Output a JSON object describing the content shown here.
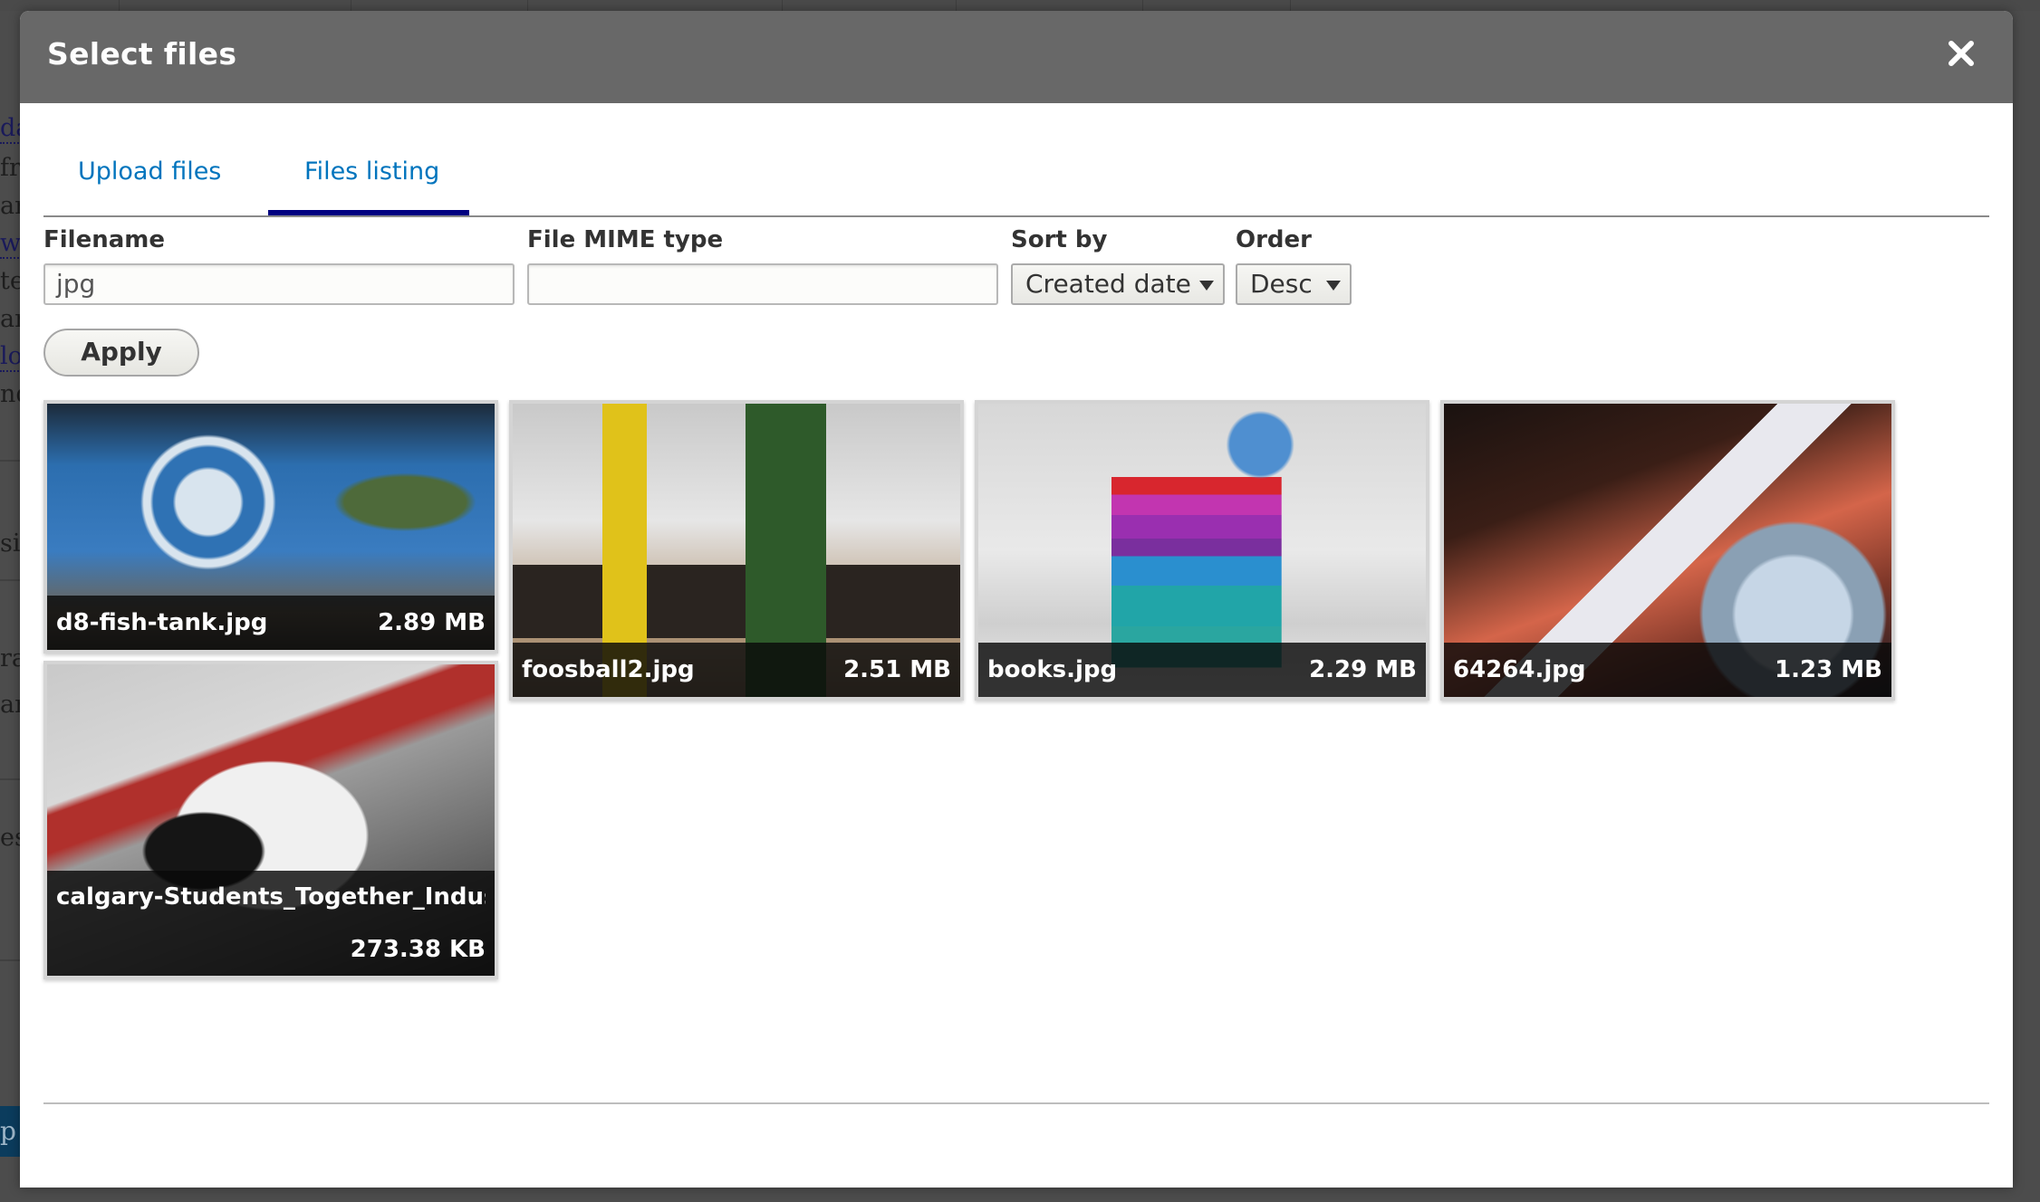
{
  "background": {
    "fragments": [
      "da",
      "fr",
      "ar",
      "wi",
      "te",
      "arg",
      "lo",
      "nd",
      "si",
      "ra",
      "ar",
      "es"
    ],
    "button_fragment": "p"
  },
  "dialog": {
    "title": "Select files",
    "close_icon": "close-icon"
  },
  "tabs": [
    {
      "label": "Upload files",
      "active": false
    },
    {
      "label": "Files listing",
      "active": true
    }
  ],
  "filters": {
    "filename": {
      "label": "Filename",
      "value": "jpg",
      "placeholder": ""
    },
    "mime": {
      "label": "File MIME type",
      "value": "",
      "placeholder": ""
    },
    "sort_by": {
      "label": "Sort by",
      "selected": "Created date"
    },
    "order": {
      "label": "Order",
      "selected": "Desc"
    },
    "apply_label": "Apply"
  },
  "files": [
    {
      "name": "d8-fish-tank.jpg",
      "size": "2.89 MB"
    },
    {
      "name": "foosball2.jpg",
      "size": "2.51 MB"
    },
    {
      "name": "books.jpg",
      "size": "2.29 MB"
    },
    {
      "name": "64264.jpg",
      "size": "1.23 MB"
    },
    {
      "name": "calgary-Students_Together_Industry_P",
      "size": "273.38 KB"
    }
  ],
  "colors": {
    "header_bg": "#686868",
    "tab_link": "#0074bd",
    "tab_active_underline": "#000080"
  }
}
